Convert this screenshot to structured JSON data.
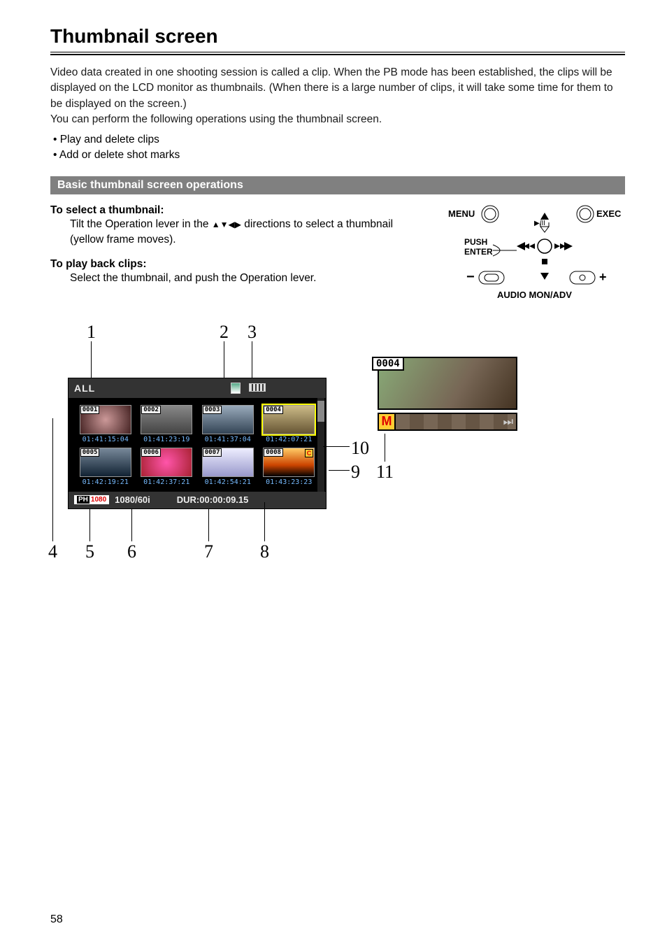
{
  "page": {
    "title": "Thumbnail screen",
    "intro1": "Video data created in one shooting session is called a clip. When the PB mode has been established, the clips will be displayed on the LCD monitor as thumbnails. (When there is a large number of clips, it will take some time for them to be displayed on the screen.)",
    "intro2": "You can perform the following operations using the thumbnail screen.",
    "bullets": [
      "Play and delete clips",
      "Add or delete shot marks"
    ],
    "section_heading": "Basic thumbnail screen operations",
    "select_head": "To select a thumbnail:",
    "select_body_a": "Tilt the Operation lever in the ",
    "select_body_b": " directions to select a thumbnail (yellow frame moves).",
    "play_head": "To play back clips:",
    "play_body": "Select the thumbnail, and push the Operation lever.",
    "page_number": "58"
  },
  "control_panel": {
    "menu": "MENU",
    "exec": "EXEC",
    "push_enter_a": "PUSH",
    "push_enter_b": "ENTER",
    "audio": "AUDIO MON/ADV",
    "minus": "−",
    "plus": "+"
  },
  "lcd": {
    "header_label": "ALL",
    "format_badge_prefix": "PH",
    "format_badge_num": "1080",
    "format_text": "1080/60i",
    "duration": "DUR:00:00:09.15",
    "clips": [
      {
        "num": "0001",
        "tc": "01:41:15:04",
        "cls": "ci1"
      },
      {
        "num": "0002",
        "tc": "01:41:23:19",
        "cls": "ci2"
      },
      {
        "num": "0003",
        "tc": "01:41:37:04",
        "cls": "ci3"
      },
      {
        "num": "0004",
        "tc": "01:42:07:21",
        "cls": "ci4"
      },
      {
        "num": "0005",
        "tc": "01:42:19:21",
        "cls": "ci5"
      },
      {
        "num": "0006",
        "tc": "01:42:37:21",
        "cls": "ci6"
      },
      {
        "num": "0007",
        "tc": "01:42:54:21",
        "cls": "ci7"
      },
      {
        "num": "0008",
        "tc": "01:43:23:23",
        "cls": "ci8",
        "mark": true
      }
    ]
  },
  "preview": {
    "clip_number": "0004",
    "m_badge": "M"
  },
  "callouts": {
    "n1": "1",
    "n2": "2",
    "n3": "3",
    "n4": "4",
    "n5": "5",
    "n6": "6",
    "n7": "7",
    "n8": "8",
    "n9": "9",
    "n10": "10",
    "n11": "11"
  }
}
